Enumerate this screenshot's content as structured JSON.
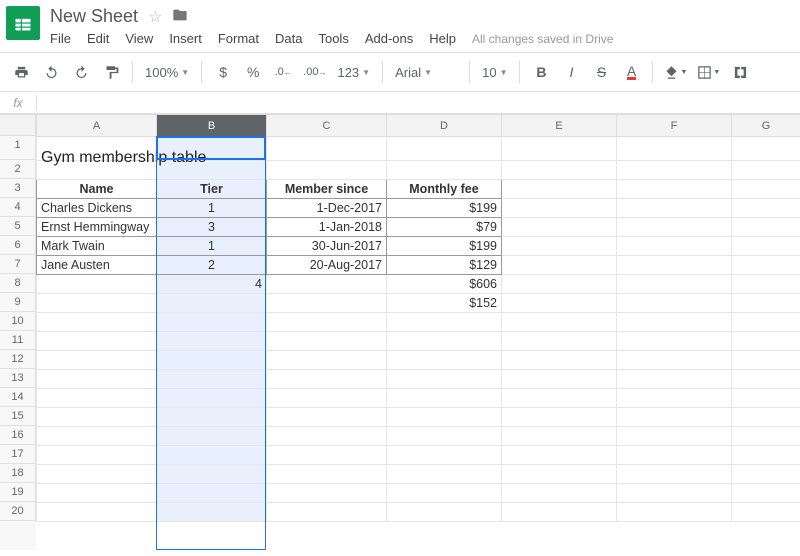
{
  "doc": {
    "title": "New Sheet",
    "status": "All changes saved in Drive"
  },
  "menu": {
    "file": "File",
    "edit": "Edit",
    "view": "View",
    "insert": "Insert",
    "format": "Format",
    "data": "Data",
    "tools": "Tools",
    "addons": "Add-ons",
    "help": "Help"
  },
  "toolbar": {
    "zoom": "100%",
    "font": "Arial",
    "size": "10",
    "currency": "$",
    "percent": "%",
    "dec_dec": ".0",
    "dec_inc": ".00",
    "numfmt": "123",
    "bold": "B",
    "italic": "I",
    "strike": "S",
    "textcolor": "A"
  },
  "fx": {
    "label": "fx"
  },
  "columns": [
    "A",
    "B",
    "C",
    "D",
    "E",
    "F",
    "G"
  ],
  "chart_data": {
    "type": "table",
    "title": "Gym membership table",
    "headers": [
      "Name",
      "Tier",
      "Member since",
      "Monthly fee"
    ],
    "rows": [
      {
        "name": "Charles Dickens",
        "tier": "1",
        "since": "1-Dec-2017",
        "fee": "$199"
      },
      {
        "name": "Ernst Hemmingway",
        "tier": "3",
        "since": "1-Jan-2018",
        "fee": "$79"
      },
      {
        "name": "Mark Twain",
        "tier": "1",
        "since": "30-Jun-2017",
        "fee": "$199"
      },
      {
        "name": "Jane Austen",
        "tier": "2",
        "since": "20-Aug-2017",
        "fee": "$129"
      }
    ],
    "summary": {
      "count": "4",
      "total": "$606",
      "avg": "$152"
    }
  }
}
